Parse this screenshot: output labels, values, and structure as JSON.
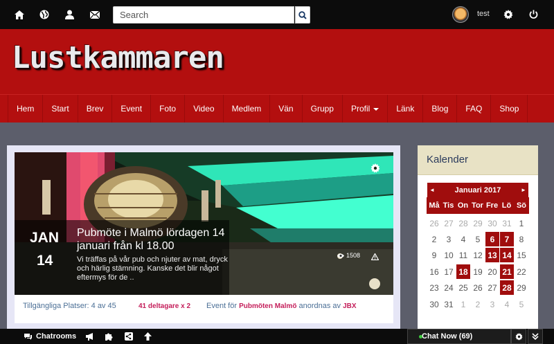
{
  "topbar": {
    "icons": [
      "home-icon",
      "globe-icon",
      "user-icon",
      "envelope-icon"
    ],
    "search_placeholder": "Search",
    "username": "test"
  },
  "logo_text": "Lustkammaren",
  "nav": {
    "items": [
      "Hem",
      "Start",
      "Brev",
      "Event",
      "Foto",
      "Video",
      "Medlem",
      "Vän",
      "Grupp",
      "Profil",
      "Länk",
      "Blog",
      "FAQ",
      "Shop"
    ]
  },
  "event": {
    "month": "JAN",
    "day": "14",
    "title": "Pubmöte i Malmö lördagen 14 januari från kl 18.00",
    "description": "Vi träffas på vår pub och njuter av mat, dryck och härlig stämning. Kanske det blir något eftermys för de ..",
    "views": "1508",
    "seats": "Tillgängliga Platser: 4 av 45",
    "participants": "41 deltagare x 2",
    "event_for_prefix": "Event för",
    "group": "Pubmöten Malmö",
    "organized_by": "anordnas av",
    "organizer": "JBX"
  },
  "calendar": {
    "title": "Kalender",
    "month": "Januari 2017",
    "prev": "◄",
    "next": "►",
    "weekdays": [
      "Må",
      "Tis",
      "On",
      "Tor",
      "Fre",
      "Lö",
      "Sö"
    ],
    "weeks": [
      [
        {
          "d": "26",
          "o": true
        },
        {
          "d": "27",
          "o": true
        },
        {
          "d": "28",
          "o": true
        },
        {
          "d": "29",
          "o": true
        },
        {
          "d": "30",
          "o": true
        },
        {
          "d": "31",
          "o": true
        },
        {
          "d": "1"
        }
      ],
      [
        {
          "d": "2"
        },
        {
          "d": "3"
        },
        {
          "d": "4"
        },
        {
          "d": "5"
        },
        {
          "d": "6",
          "e": true
        },
        {
          "d": "7",
          "e": true
        },
        {
          "d": "8"
        }
      ],
      [
        {
          "d": "9"
        },
        {
          "d": "10"
        },
        {
          "d": "11"
        },
        {
          "d": "12"
        },
        {
          "d": "13",
          "e": true
        },
        {
          "d": "14",
          "e": true
        },
        {
          "d": "15"
        }
      ],
      [
        {
          "d": "16"
        },
        {
          "d": "17"
        },
        {
          "d": "18",
          "e": true
        },
        {
          "d": "19"
        },
        {
          "d": "20"
        },
        {
          "d": "21",
          "e": true
        },
        {
          "d": "22"
        }
      ],
      [
        {
          "d": "23"
        },
        {
          "d": "24"
        },
        {
          "d": "25"
        },
        {
          "d": "26"
        },
        {
          "d": "27"
        },
        {
          "d": "28",
          "e": true
        },
        {
          "d": "29"
        }
      ],
      [
        {
          "d": "30"
        },
        {
          "d": "31"
        },
        {
          "d": "1",
          "o": true
        },
        {
          "d": "2",
          "o": true
        },
        {
          "d": "3",
          "o": true
        },
        {
          "d": "4",
          "o": true
        },
        {
          "d": "5",
          "o": true
        }
      ]
    ]
  },
  "bottombar": {
    "chatrooms": "Chatrooms",
    "chat_now": "Chat Now (69)"
  },
  "colors": {
    "brand_red": "#b30f0f",
    "calendar_red": "#a00d0d",
    "accent_pink": "#c41e5a",
    "link_blue": "#4b6f96"
  }
}
